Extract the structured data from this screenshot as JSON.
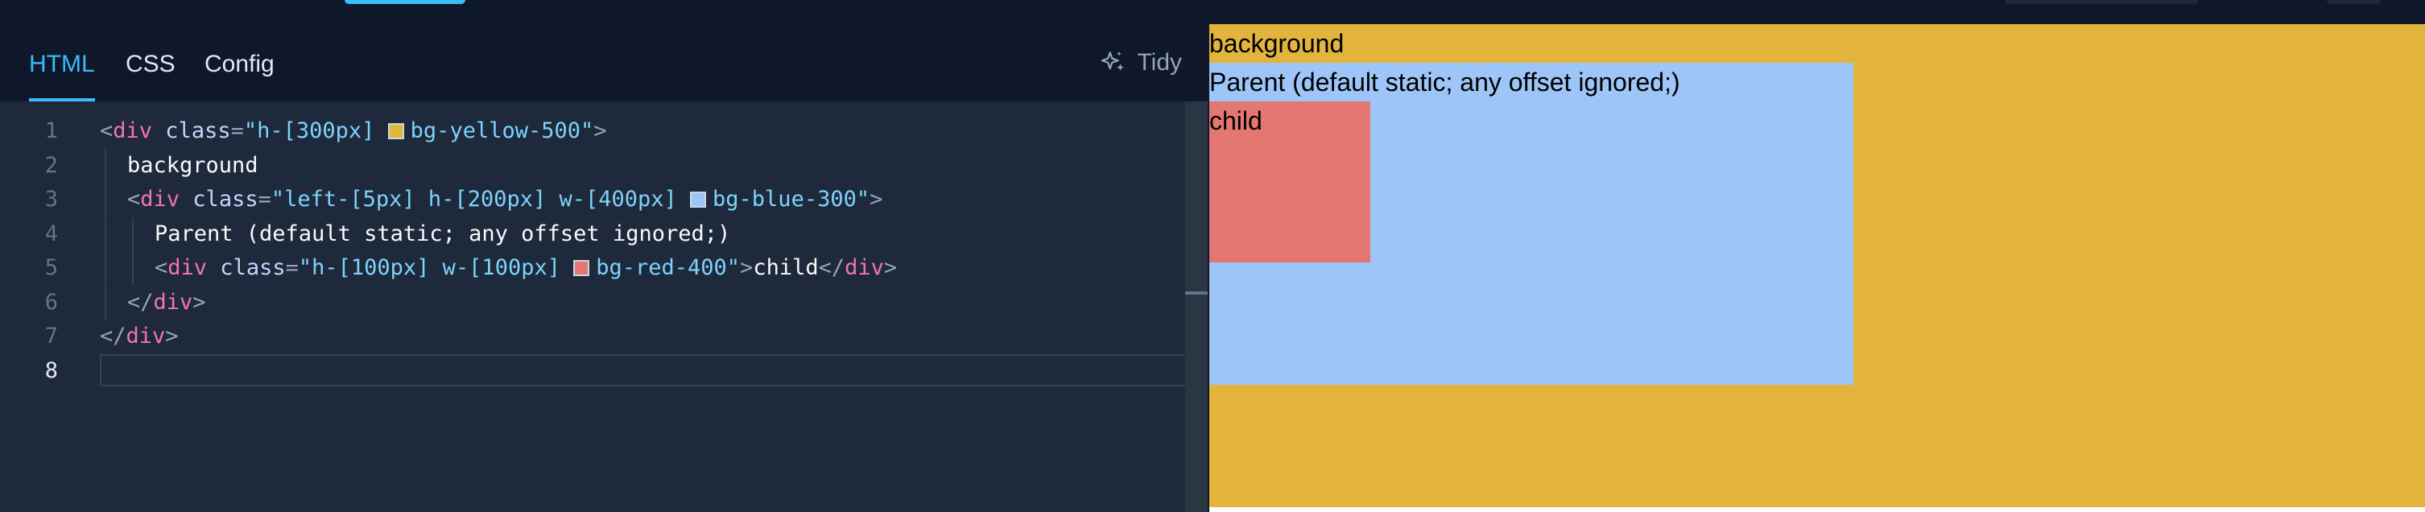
{
  "tabs": [
    {
      "label": "HTML",
      "active": true
    },
    {
      "label": "CSS",
      "active": false
    },
    {
      "label": "Config",
      "active": false
    }
  ],
  "toolbar": {
    "tidy_label": "Tidy",
    "tidy_icon": "sparkles-icon"
  },
  "editor": {
    "current_line": 8,
    "lines": [
      {
        "num": "1",
        "indent": 0,
        "tokens": [
          {
            "t": "<",
            "c": "punct"
          },
          {
            "t": "div",
            "c": "tag"
          },
          {
            "t": " class",
            "c": "attr"
          },
          {
            "t": "=",
            "c": "punct"
          },
          {
            "t": "\"h-[300px] ",
            "c": "str"
          },
          {
            "swatch": "#e3b43c"
          },
          {
            "t": "bg-yellow-500\"",
            "c": "str"
          },
          {
            "t": ">",
            "c": "punct"
          }
        ]
      },
      {
        "num": "2",
        "indent": 1,
        "tokens": [
          {
            "t": "background",
            "c": "text"
          }
        ]
      },
      {
        "num": "3",
        "indent": 1,
        "tokens": [
          {
            "t": "<",
            "c": "punct"
          },
          {
            "t": "div",
            "c": "tag"
          },
          {
            "t": " class",
            "c": "attr"
          },
          {
            "t": "=",
            "c": "punct"
          },
          {
            "t": "\"left-[5px] h-[200px] w-[400px] ",
            "c": "str"
          },
          {
            "swatch": "#9dc5f8"
          },
          {
            "t": "bg-blue-300\"",
            "c": "str"
          },
          {
            "t": ">",
            "c": "punct"
          }
        ]
      },
      {
        "num": "4",
        "indent": 2,
        "tokens": [
          {
            "t": "Parent (default static; any offset ignored;)",
            "c": "text"
          }
        ]
      },
      {
        "num": "5",
        "indent": 2,
        "tokens": [
          {
            "t": "<",
            "c": "punct"
          },
          {
            "t": "div",
            "c": "tag"
          },
          {
            "t": " class",
            "c": "attr"
          },
          {
            "t": "=",
            "c": "punct"
          },
          {
            "t": "\"h-[100px] w-[100px] ",
            "c": "str"
          },
          {
            "swatch": "#e57773"
          },
          {
            "t": "bg-red-400\"",
            "c": "str"
          },
          {
            "t": ">",
            "c": "punct"
          },
          {
            "t": "child",
            "c": "text"
          },
          {
            "t": "</",
            "c": "punct"
          },
          {
            "t": "div",
            "c": "tag"
          },
          {
            "t": ">",
            "c": "punct"
          }
        ]
      },
      {
        "num": "6",
        "indent": 1,
        "tokens": [
          {
            "t": "</",
            "c": "punct"
          },
          {
            "t": "div",
            "c": "tag"
          },
          {
            "t": ">",
            "c": "punct"
          }
        ]
      },
      {
        "num": "7",
        "indent": 0,
        "tokens": [
          {
            "t": "</",
            "c": "punct"
          },
          {
            "t": "div",
            "c": "tag"
          },
          {
            "t": ">",
            "c": "punct"
          }
        ]
      },
      {
        "num": "8",
        "indent": 0,
        "tokens": []
      }
    ]
  },
  "preview": {
    "background_text": "background",
    "parent_text": "Parent (default static; any offset ignored;)",
    "child_text": "child",
    "colors": {
      "yellow": "#e3b43c",
      "blue": "#9dc5f8",
      "red": "#e57773"
    }
  },
  "colors": {
    "accent": "#38bdf8",
    "editor_bg": "#1e293b",
    "header_bg": "#0f172a"
  }
}
